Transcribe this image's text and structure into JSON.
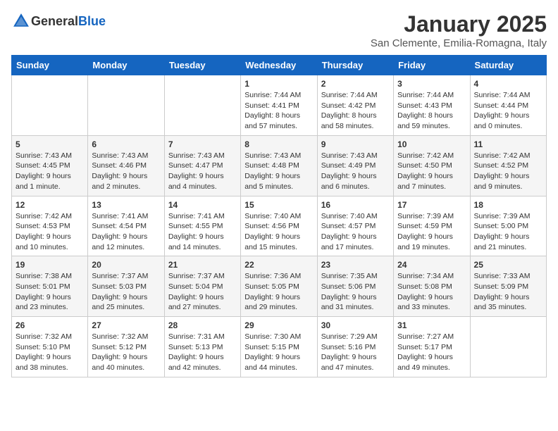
{
  "header": {
    "logo_general": "General",
    "logo_blue": "Blue",
    "title": "January 2025",
    "subtitle": "San Clemente, Emilia-Romagna, Italy"
  },
  "weekdays": [
    "Sunday",
    "Monday",
    "Tuesday",
    "Wednesday",
    "Thursday",
    "Friday",
    "Saturday"
  ],
  "weeks": [
    [
      {
        "day": "",
        "sunrise": "",
        "sunset": "",
        "daylight": ""
      },
      {
        "day": "",
        "sunrise": "",
        "sunset": "",
        "daylight": ""
      },
      {
        "day": "",
        "sunrise": "",
        "sunset": "",
        "daylight": ""
      },
      {
        "day": "1",
        "sunrise": "Sunrise: 7:44 AM",
        "sunset": "Sunset: 4:41 PM",
        "daylight": "Daylight: 8 hours and 57 minutes."
      },
      {
        "day": "2",
        "sunrise": "Sunrise: 7:44 AM",
        "sunset": "Sunset: 4:42 PM",
        "daylight": "Daylight: 8 hours and 58 minutes."
      },
      {
        "day": "3",
        "sunrise": "Sunrise: 7:44 AM",
        "sunset": "Sunset: 4:43 PM",
        "daylight": "Daylight: 8 hours and 59 minutes."
      },
      {
        "day": "4",
        "sunrise": "Sunrise: 7:44 AM",
        "sunset": "Sunset: 4:44 PM",
        "daylight": "Daylight: 9 hours and 0 minutes."
      }
    ],
    [
      {
        "day": "5",
        "sunrise": "Sunrise: 7:43 AM",
        "sunset": "Sunset: 4:45 PM",
        "daylight": "Daylight: 9 hours and 1 minute."
      },
      {
        "day": "6",
        "sunrise": "Sunrise: 7:43 AM",
        "sunset": "Sunset: 4:46 PM",
        "daylight": "Daylight: 9 hours and 2 minutes."
      },
      {
        "day": "7",
        "sunrise": "Sunrise: 7:43 AM",
        "sunset": "Sunset: 4:47 PM",
        "daylight": "Daylight: 9 hours and 4 minutes."
      },
      {
        "day": "8",
        "sunrise": "Sunrise: 7:43 AM",
        "sunset": "Sunset: 4:48 PM",
        "daylight": "Daylight: 9 hours and 5 minutes."
      },
      {
        "day": "9",
        "sunrise": "Sunrise: 7:43 AM",
        "sunset": "Sunset: 4:49 PM",
        "daylight": "Daylight: 9 hours and 6 minutes."
      },
      {
        "day": "10",
        "sunrise": "Sunrise: 7:42 AM",
        "sunset": "Sunset: 4:50 PM",
        "daylight": "Daylight: 9 hours and 7 minutes."
      },
      {
        "day": "11",
        "sunrise": "Sunrise: 7:42 AM",
        "sunset": "Sunset: 4:52 PM",
        "daylight": "Daylight: 9 hours and 9 minutes."
      }
    ],
    [
      {
        "day": "12",
        "sunrise": "Sunrise: 7:42 AM",
        "sunset": "Sunset: 4:53 PM",
        "daylight": "Daylight: 9 hours and 10 minutes."
      },
      {
        "day": "13",
        "sunrise": "Sunrise: 7:41 AM",
        "sunset": "Sunset: 4:54 PM",
        "daylight": "Daylight: 9 hours and 12 minutes."
      },
      {
        "day": "14",
        "sunrise": "Sunrise: 7:41 AM",
        "sunset": "Sunset: 4:55 PM",
        "daylight": "Daylight: 9 hours and 14 minutes."
      },
      {
        "day": "15",
        "sunrise": "Sunrise: 7:40 AM",
        "sunset": "Sunset: 4:56 PM",
        "daylight": "Daylight: 9 hours and 15 minutes."
      },
      {
        "day": "16",
        "sunrise": "Sunrise: 7:40 AM",
        "sunset": "Sunset: 4:57 PM",
        "daylight": "Daylight: 9 hours and 17 minutes."
      },
      {
        "day": "17",
        "sunrise": "Sunrise: 7:39 AM",
        "sunset": "Sunset: 4:59 PM",
        "daylight": "Daylight: 9 hours and 19 minutes."
      },
      {
        "day": "18",
        "sunrise": "Sunrise: 7:39 AM",
        "sunset": "Sunset: 5:00 PM",
        "daylight": "Daylight: 9 hours and 21 minutes."
      }
    ],
    [
      {
        "day": "19",
        "sunrise": "Sunrise: 7:38 AM",
        "sunset": "Sunset: 5:01 PM",
        "daylight": "Daylight: 9 hours and 23 minutes."
      },
      {
        "day": "20",
        "sunrise": "Sunrise: 7:37 AM",
        "sunset": "Sunset: 5:03 PM",
        "daylight": "Daylight: 9 hours and 25 minutes."
      },
      {
        "day": "21",
        "sunrise": "Sunrise: 7:37 AM",
        "sunset": "Sunset: 5:04 PM",
        "daylight": "Daylight: 9 hours and 27 minutes."
      },
      {
        "day": "22",
        "sunrise": "Sunrise: 7:36 AM",
        "sunset": "Sunset: 5:05 PM",
        "daylight": "Daylight: 9 hours and 29 minutes."
      },
      {
        "day": "23",
        "sunrise": "Sunrise: 7:35 AM",
        "sunset": "Sunset: 5:06 PM",
        "daylight": "Daylight: 9 hours and 31 minutes."
      },
      {
        "day": "24",
        "sunrise": "Sunrise: 7:34 AM",
        "sunset": "Sunset: 5:08 PM",
        "daylight": "Daylight: 9 hours and 33 minutes."
      },
      {
        "day": "25",
        "sunrise": "Sunrise: 7:33 AM",
        "sunset": "Sunset: 5:09 PM",
        "daylight": "Daylight: 9 hours and 35 minutes."
      }
    ],
    [
      {
        "day": "26",
        "sunrise": "Sunrise: 7:32 AM",
        "sunset": "Sunset: 5:10 PM",
        "daylight": "Daylight: 9 hours and 38 minutes."
      },
      {
        "day": "27",
        "sunrise": "Sunrise: 7:32 AM",
        "sunset": "Sunset: 5:12 PM",
        "daylight": "Daylight: 9 hours and 40 minutes."
      },
      {
        "day": "28",
        "sunrise": "Sunrise: 7:31 AM",
        "sunset": "Sunset: 5:13 PM",
        "daylight": "Daylight: 9 hours and 42 minutes."
      },
      {
        "day": "29",
        "sunrise": "Sunrise: 7:30 AM",
        "sunset": "Sunset: 5:15 PM",
        "daylight": "Daylight: 9 hours and 44 minutes."
      },
      {
        "day": "30",
        "sunrise": "Sunrise: 7:29 AM",
        "sunset": "Sunset: 5:16 PM",
        "daylight": "Daylight: 9 hours and 47 minutes."
      },
      {
        "day": "31",
        "sunrise": "Sunrise: 7:27 AM",
        "sunset": "Sunset: 5:17 PM",
        "daylight": "Daylight: 9 hours and 49 minutes."
      },
      {
        "day": "",
        "sunrise": "",
        "sunset": "",
        "daylight": ""
      }
    ]
  ]
}
